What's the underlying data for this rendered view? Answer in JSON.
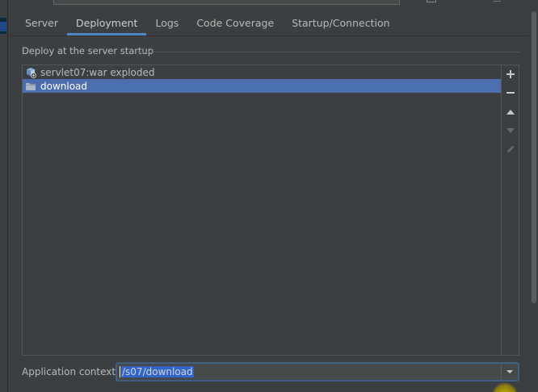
{
  "tabs": [
    {
      "label": "Server"
    },
    {
      "label": "Deployment"
    },
    {
      "label": "Logs"
    },
    {
      "label": "Code Coverage"
    },
    {
      "label": "Startup/Connection"
    }
  ],
  "active_tab": "Deployment",
  "deploy": {
    "group_title": "Deploy at the server startup",
    "items": [
      {
        "label": "servlet07:war exploded",
        "icon": "artifact-icon",
        "selected": false
      },
      {
        "label": "download",
        "icon": "folder-icon",
        "selected": true
      }
    ],
    "tools": [
      {
        "name": "add",
        "glyph": "+",
        "enabled": true
      },
      {
        "name": "remove",
        "glyph": "−",
        "enabled": true
      },
      {
        "name": "move-up",
        "glyph": "▲",
        "enabled": true
      },
      {
        "name": "move-down",
        "glyph": "▼",
        "enabled": false
      },
      {
        "name": "edit",
        "glyph": "✎",
        "enabled": false
      }
    ]
  },
  "application_context": {
    "label": "Application context:",
    "value": "/s07/download"
  },
  "colors": {
    "background": "#3c3f41",
    "selection": "#4b6eaf",
    "tab_underline": "#4a88c7",
    "text_selection": "#2f65ca",
    "focus_border": "#3d6185"
  }
}
